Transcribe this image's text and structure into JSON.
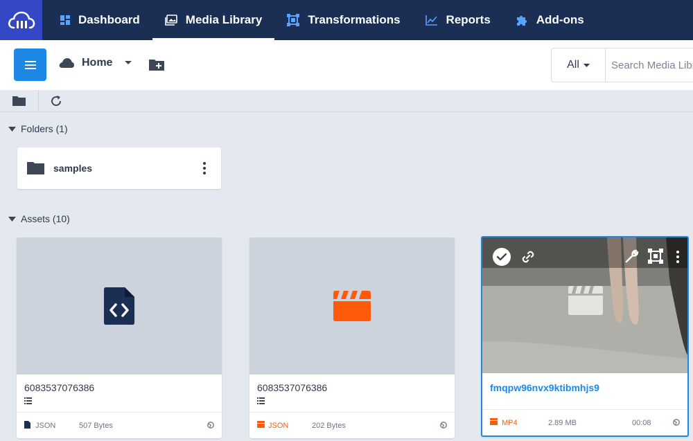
{
  "nav": {
    "items": [
      {
        "label": "Dashboard",
        "icon": "dashboard-icon"
      },
      {
        "label": "Media Library",
        "icon": "media-library-icon",
        "active": true
      },
      {
        "label": "Transformations",
        "icon": "transformations-icon"
      },
      {
        "label": "Reports",
        "icon": "reports-icon"
      },
      {
        "label": "Add-ons",
        "icon": "puzzle-icon"
      }
    ]
  },
  "toolbar": {
    "location_label": "Home",
    "filter_label": "All",
    "search_placeholder": "Search Media Library"
  },
  "folders_section": {
    "title": "Folders (1)",
    "items": [
      {
        "name": "samples"
      }
    ]
  },
  "assets_section": {
    "title": "Assets (10)",
    "items": [
      {
        "name": "6083537076386",
        "type": "JSON",
        "size": "507 Bytes",
        "duration": "",
        "type_color": "#1b2e54"
      },
      {
        "name": "6083537076386",
        "type": "JSON",
        "size": "202 Bytes",
        "duration": "",
        "type_color": "#ff5a0a"
      },
      {
        "name": "fmqpw96nvx9ktibmhjs9",
        "type": "MP4",
        "size": "2.89 MB",
        "duration": "00:08",
        "type_color": "#ff5a0a",
        "selected": true
      }
    ]
  },
  "colors": {
    "nav_bg": "#1b2e54",
    "logo_bg": "#3448c5",
    "accent": "#1e88e5",
    "orange": "#ff5a0a"
  }
}
